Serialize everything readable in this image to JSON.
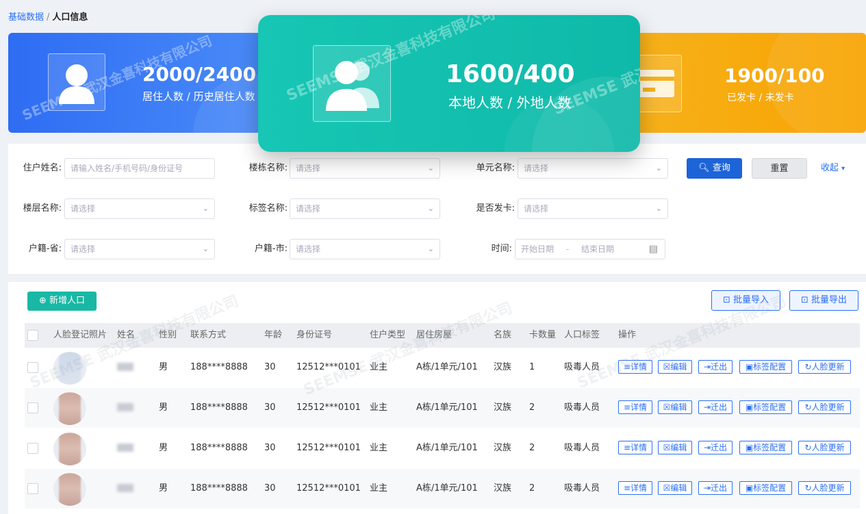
{
  "breadcrumb": {
    "parent": "基础数据",
    "separator": "/",
    "current": "人口信息"
  },
  "stats": {
    "resident": {
      "value": "2000/2400",
      "label": "居住人数 / 历史居住人数"
    },
    "local": {
      "value": "1600/400",
      "label": "本地人数 / 外地人数"
    },
    "card": {
      "value": "1900/100",
      "label": "已发卡 / 未发卡"
    }
  },
  "watermark": {
    "brand": "SEEMSE",
    "company": "武汉金喜科技有限公司"
  },
  "filters": {
    "resident_name": {
      "label": "住户姓名:",
      "placeholder": "请输入姓名/手机号码/身份证号"
    },
    "building": {
      "label": "楼栋名称:",
      "placeholder": "请选择"
    },
    "unit": {
      "label": "单元名称:",
      "placeholder": "请选择"
    },
    "floor": {
      "label": "楼层名称:",
      "placeholder": "请选择"
    },
    "tag": {
      "label": "标签名称:",
      "placeholder": "请选择"
    },
    "card_issued": {
      "label": "是否发卡:",
      "placeholder": "请选择"
    },
    "province": {
      "label": "户籍-省:",
      "placeholder": "请选择"
    },
    "city": {
      "label": "户籍-市:",
      "placeholder": "请选择"
    },
    "time": {
      "label": "时间:",
      "start": "开始日期",
      "dash": "-",
      "end": "结束日期"
    }
  },
  "actions": {
    "query": "查询",
    "reset": "重置",
    "collapse": "收起",
    "add": "新增人口",
    "import": "批量导入",
    "export": "批量导出"
  },
  "table": {
    "headers": [
      "人脸登记照片",
      "姓名",
      "性别",
      "联系方式",
      "年龄",
      "身份证号",
      "住户类型",
      "居住房屋",
      "名族",
      "卡数量",
      "人口标签",
      "操作"
    ],
    "rows": [
      {
        "gender": "男",
        "phone": "188****8888",
        "age": "30",
        "id": "12512***0101",
        "type": "业主",
        "house": "A栋/1单元/101",
        "ethnic": "汉族",
        "cards": "1",
        "tag": "吸毒人员"
      },
      {
        "gender": "男",
        "phone": "188****8888",
        "age": "30",
        "id": "12512***0101",
        "type": "业主",
        "house": "A栋/1单元/101",
        "ethnic": "汉族",
        "cards": "2",
        "tag": "吸毒人员"
      },
      {
        "gender": "男",
        "phone": "188****8888",
        "age": "30",
        "id": "12512***0101",
        "type": "业主",
        "house": "A栋/1单元/101",
        "ethnic": "汉族",
        "cards": "2",
        "tag": "吸毒人员"
      },
      {
        "gender": "男",
        "phone": "188****8888",
        "age": "30",
        "id": "12512***0101",
        "type": "业主",
        "house": "A栋/1单元/101",
        "ethnic": "汉族",
        "cards": "2",
        "tag": "吸毒人员"
      }
    ],
    "row_actions": {
      "detail": "详情",
      "edit": "编辑",
      "move_out": "迁出",
      "tag_config": "标签配置",
      "face_update": "人脸更新"
    }
  },
  "colors": {
    "primary": "#1c64d8",
    "teal": "#17c6b4",
    "orange": "#f6b21c",
    "blue": "#2e6df3"
  }
}
